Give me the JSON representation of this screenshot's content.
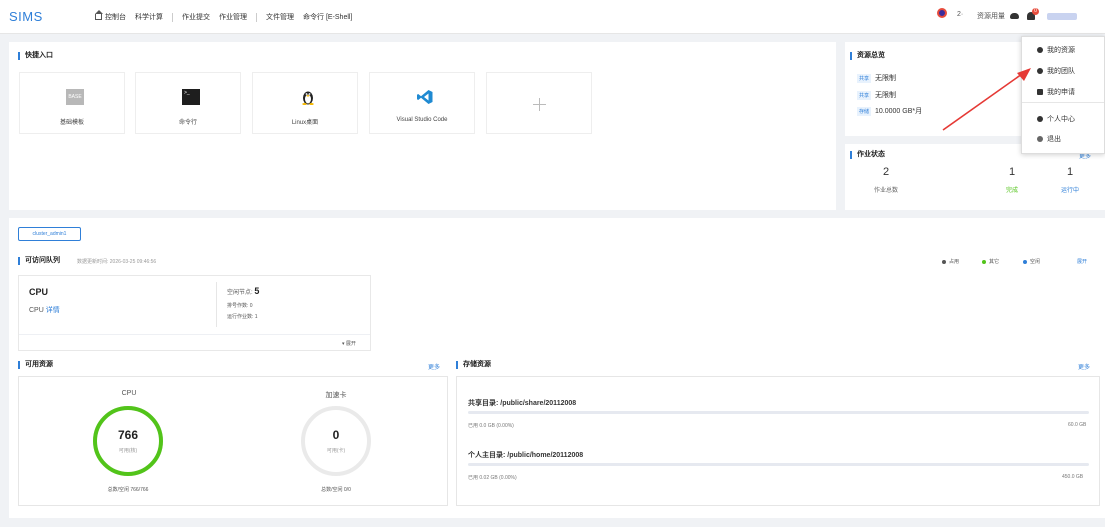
{
  "app": {
    "logo": "SIMS"
  },
  "nav": {
    "items": [
      {
        "label": "控制台"
      },
      {
        "label": "科学计算"
      },
      {
        "label": "作业提交"
      },
      {
        "label": "作业管理"
      },
      {
        "label": "文件管理"
      },
      {
        "label": "命令行 [E-Shell]"
      }
    ]
  },
  "topright": {
    "count": "2·",
    "usage": "资源用量",
    "bell_badge": "0"
  },
  "quick_entry": {
    "title": "快捷入口",
    "cards": [
      {
        "label": "基础模板",
        "icon": "base-template-icon",
        "icon_text": "BASE"
      },
      {
        "label": "命令行",
        "icon": "terminal-icon"
      },
      {
        "label": "Linux桌面",
        "icon": "linux-penguin-icon"
      },
      {
        "label": "Visual Studio Code",
        "icon": "vscode-icon"
      },
      {
        "label": "",
        "icon": "add-icon"
      }
    ]
  },
  "resource_summary": {
    "title": "资源总览",
    "rows": [
      {
        "tag": "共享",
        "value": "无限制"
      },
      {
        "tag": "共享",
        "value": "无限制"
      },
      {
        "tag": "存储",
        "value": "10.0000 GB*月"
      }
    ]
  },
  "job_status": {
    "title": "作业状态",
    "more": "更多",
    "items": [
      {
        "value": "2",
        "label": "作业总数",
        "color": "#666666"
      },
      {
        "value": "1",
        "label": "完成",
        "color": "#52c41a"
      },
      {
        "value": "1",
        "label": "运行中",
        "color": "#2f7fd8"
      }
    ]
  },
  "dropdown": {
    "items": [
      {
        "label": "我的资源",
        "icon": "cube-icon"
      },
      {
        "label": "我的团队",
        "icon": "team-icon"
      },
      {
        "label": "我的申请",
        "icon": "application-icon"
      },
      {
        "label": "个人中心",
        "icon": "user-icon"
      },
      {
        "label": "退出",
        "icon": "logout-icon"
      }
    ]
  },
  "cluster": {
    "tab": "cluster_admin1"
  },
  "queue": {
    "title": "可访问队列",
    "update_time": "数据更新时间: 2026-03-25 09:46:56",
    "legend": [
      {
        "label": "占用",
        "color": "#555555"
      },
      {
        "label": "其它",
        "color": "#52c41a"
      },
      {
        "label": "空闲",
        "color": "#2f7fd8"
      }
    ],
    "expand_all": "展开",
    "card": {
      "name": "CPU",
      "sub_name": "CPU",
      "detail_link": "详情",
      "idle_nodes_label": "空闲节点:",
      "idle_nodes_value": "5",
      "queued_jobs": "排号作数: 0",
      "running_jobs": "运行作业数: 1",
      "expand": "展开"
    }
  },
  "available": {
    "title": "可用资源",
    "more": "更多",
    "gauges": [
      {
        "name": "CPU",
        "value": "766",
        "unit": "可用(核)",
        "total": "总数/空闲 766/766",
        "fill": 1.0
      },
      {
        "name": "加速卡",
        "value": "0",
        "unit": "可用(卡)",
        "total": "总数/空闲 0/0",
        "fill": 0.0
      }
    ]
  },
  "storage": {
    "title": "存储资源",
    "more": "更多",
    "items": [
      {
        "label": "共享目录: /public/share/20112008",
        "used": "已用 0.0 GB (0.00%)",
        "total": "60.0 GB"
      },
      {
        "label": "个人主目录: /public/home/20112008",
        "used": "已用 0.02 GB (0.00%)",
        "total": "450.0 GB"
      }
    ]
  }
}
